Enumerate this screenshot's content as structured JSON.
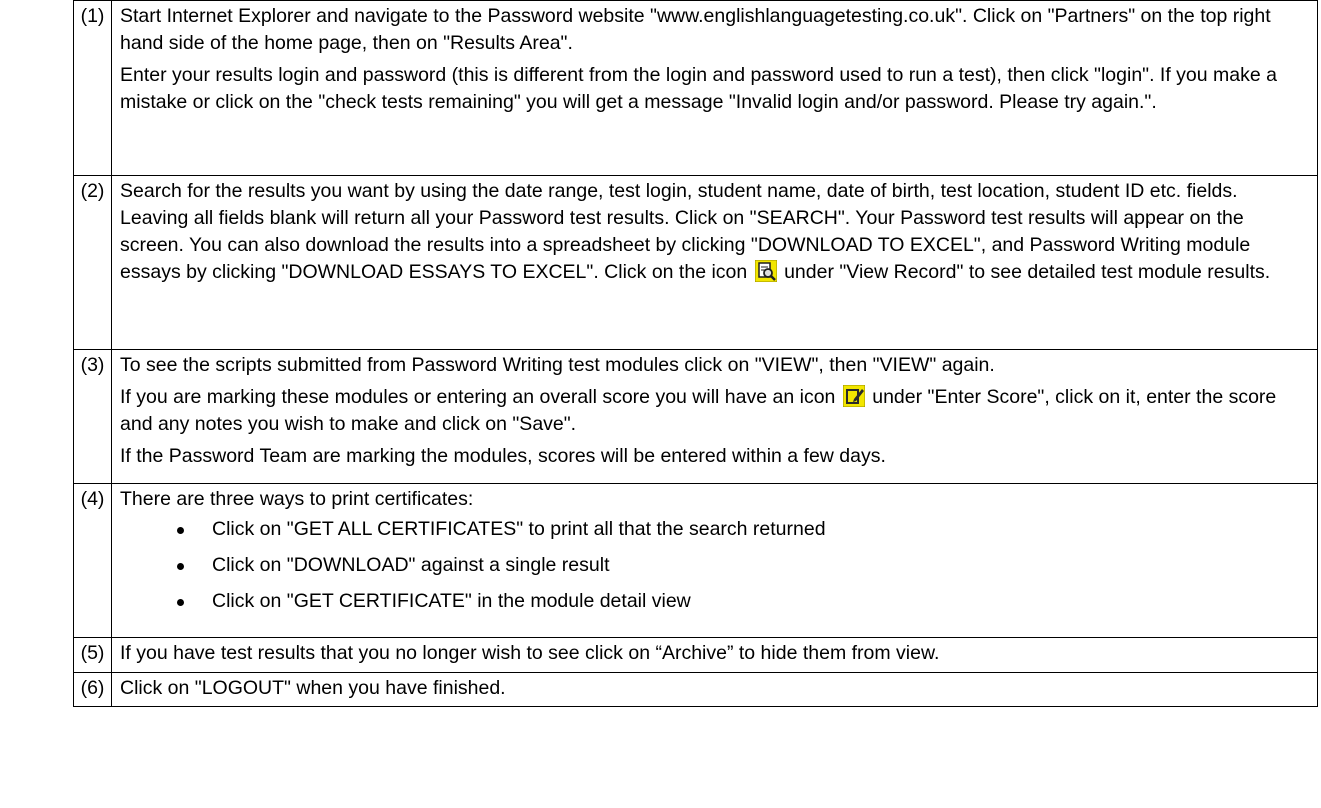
{
  "steps": [
    {
      "number": "(1)",
      "paragraphs": [
        "Start Internet Explorer and navigate to the Password website \"www.englishlanguagetesting.co.uk\". Click on \"Partners\" on the top right hand side of the home page, then on \"Results Area\".",
        "Enter your results login and password (this is different from the login and password used to run a test), then click \"login\". If you make a mistake or click on the \"check tests remaining\" you will get a message \"Invalid login and/or password. Please try again.\"."
      ]
    },
    {
      "number": "(2)",
      "text_before_icon": "Search for the results you want by using the date range, test login, student name, date of birth, test location, student ID etc. fields. Leaving all fields blank will return all your Password test results. Click on \"SEARCH\". Your Password test results will appear on the screen. You can also download the results into a spreadsheet by clicking \"DOWNLOAD TO EXCEL\", and Password Writing module essays by clicking \"DOWNLOAD ESSAYS TO EXCEL\". Click on the icon",
      "icon": "view-record-icon",
      "text_after_icon": "under \"View Record\" to see detailed test module results."
    },
    {
      "number": "(3)",
      "paragraph_1": "To see the scripts submitted from Password Writing test modules click on \"VIEW\", then \"VIEW\" again.",
      "paragraph_2_before_icon": "If you are marking these modules or entering an overall score you will have an icon",
      "icon": "enter-score-icon",
      "paragraph_2_after_icon": "under \"Enter Score\", click on it, enter the score and any notes you wish to make and click on \"Save\".",
      "paragraph_3": "If the Password Team are marking the modules, scores will be entered within a few days."
    },
    {
      "number": "(4)",
      "intro": "There are three ways to print certificates:",
      "bullets": [
        "Click on \"GET ALL CERTIFICATES\" to print all that the search returned",
        "Click on \"DOWNLOAD\" against a single result",
        "Click on \"GET CERTIFICATE\" in the module detail view"
      ]
    },
    {
      "number": "(5)",
      "text": "If you have test results that you no longer wish to see click on “Archive” to hide them from view."
    },
    {
      "number": "(6)",
      "text": "Click on \"LOGOUT\" when you have finished."
    }
  ],
  "colors": {
    "border": "#000000",
    "text": "#000000",
    "icon_fill": "#f2e600",
    "icon_dark": "#1f1f1f"
  }
}
